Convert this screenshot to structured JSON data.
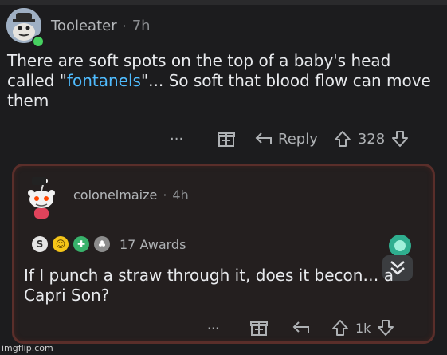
{
  "post": {
    "username": "Tooleater",
    "separator": "·",
    "time": "7h",
    "body_before": "There are soft spots on the top of a baby's head called \"",
    "body_link": "fontanels",
    "body_after": "\"... So soft that blood flow can move them",
    "more_label": "···",
    "reply_label": "Reply",
    "vote_count": "328"
  },
  "reply": {
    "username": "colonelmaize",
    "separator": "·",
    "time": "4h",
    "awards_count": "17 Awards",
    "body": "If I punch a straw through it, does it becon… a Capri Son?",
    "more_label": "···",
    "vote_count": "1k"
  },
  "watermark": "imgflip.com",
  "colors": {
    "background": "#1c1c1e",
    "link": "#4fbcff",
    "reply_border": "#5a2e2a",
    "online": "#46d160"
  },
  "icons": [
    "avatar-image",
    "gift-icon",
    "reply-arrow-icon",
    "upvote-icon",
    "downvote-icon",
    "snoo-avatar",
    "award-icons",
    "chevron-down-icon"
  ]
}
